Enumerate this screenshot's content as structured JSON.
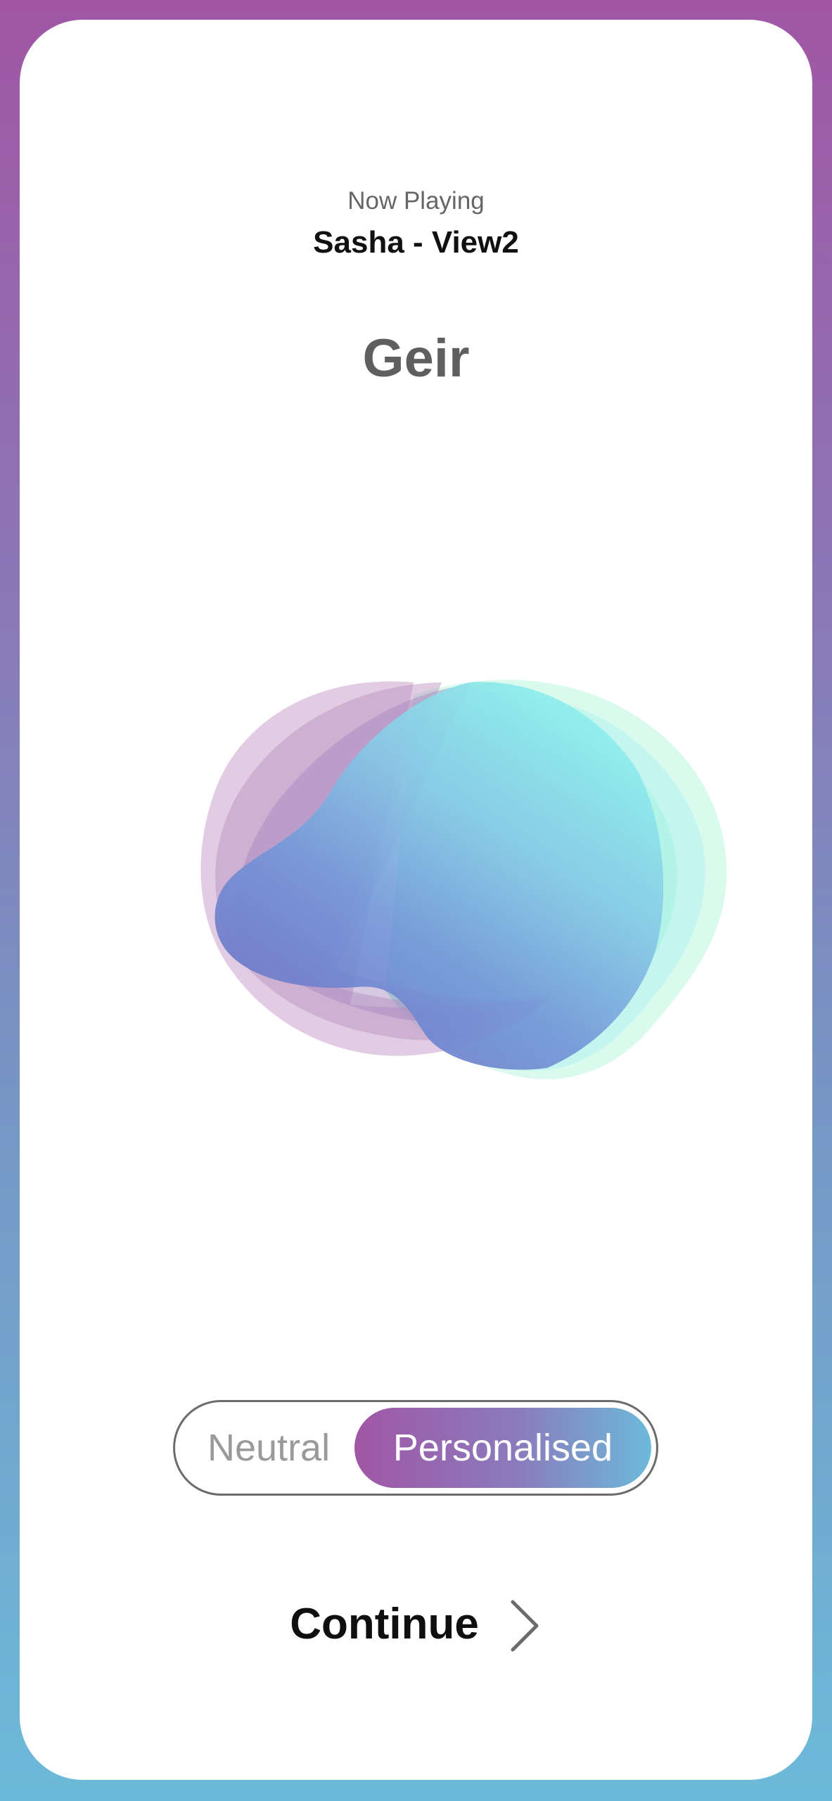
{
  "header": {
    "now_playing_label": "Now Playing",
    "track_title": "Sasha - View2"
  },
  "voice": {
    "name": "Geir"
  },
  "mode_toggle": {
    "options": [
      "Neutral",
      "Personalised"
    ],
    "selected": "Personalised"
  },
  "continue": {
    "label": "Continue",
    "icon": "chevron-right-icon"
  },
  "colors": {
    "gradient_top": "#a156a5",
    "gradient_bottom": "#6cbad9",
    "blob_cyan": "#8ef0ec",
    "blob_blue": "#6f7fcf",
    "blob_lilac": "#c9a3cc",
    "blob_mint": "#b9f6df"
  }
}
